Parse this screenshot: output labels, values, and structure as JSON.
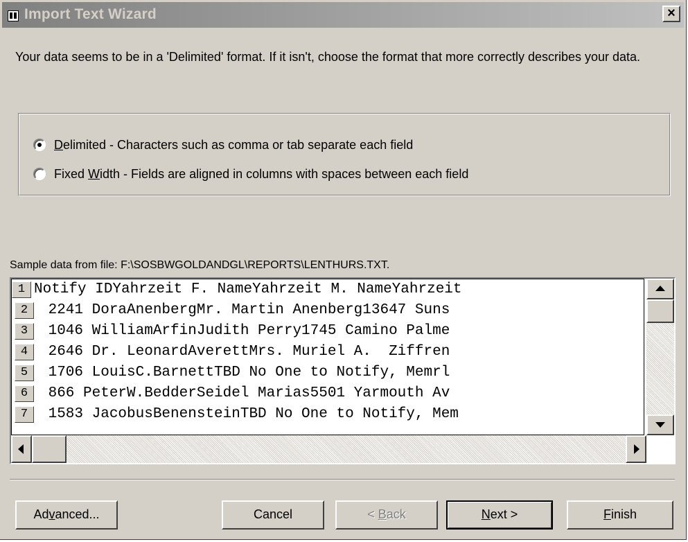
{
  "window": {
    "title": "Import Text Wizard",
    "close_label": "×"
  },
  "intro_text": "Your data seems to be in a 'Delimited' format. If it isn't, choose the format that more correctly describes your data.",
  "format_options": [
    {
      "label_accel": "D",
      "label_rest": "elimited - Characters such as comma or tab separate each field",
      "selected": true
    },
    {
      "label_before": "Fixed ",
      "label_accel": "W",
      "label_rest": "idth - Fields are aligned in columns with spaces between each field",
      "selected": false
    }
  ],
  "sample_label": "Sample data from file: F:\\SOSBWGOLDANDGL\\REPORTS\\LENTHURS.TXT.",
  "preview_rows": [
    {
      "num": "1",
      "text": "Notify IDYahrzeit F. NameYahrzeit M. NameYahrzeit"
    },
    {
      "num": "2",
      "text": " 2241 DoraAnenbergMr. Martin Anenberg13647 Suns"
    },
    {
      "num": "3",
      "text": " 1046 WilliamArfinJudith Perry1745 Camino Palme"
    },
    {
      "num": "4",
      "text": " 2646 Dr. LeonardAverettMrs. Muriel A.  Ziffren"
    },
    {
      "num": "5",
      "text": " 1706 LouisC.BarnettTBD No One to Notify, Memrl"
    },
    {
      "num": "6",
      "text": " 866 PeterW.BedderSeidel Marias5501 Yarmouth Av"
    },
    {
      "num": "7",
      "text": " 1583 JacobusBenensteinTBD No One to Notify, Mem"
    }
  ],
  "buttons": {
    "advanced": {
      "before": "Ad",
      "accel": "v",
      "after": "anced..."
    },
    "cancel": "Cancel",
    "back": {
      "before": "< ",
      "accel": "B",
      "after": "ack"
    },
    "next": {
      "before": "",
      "accel": "N",
      "after": "ext >"
    },
    "finish": {
      "before": "",
      "accel": "F",
      "after": "inish"
    }
  },
  "colors": {
    "face": "#d4d0c8",
    "title_gradient_start": "#808080",
    "title_gradient_end": "#c0c0c0"
  },
  "icons": [
    "app-icon",
    "close-icon",
    "scroll-up-arrow-icon",
    "scroll-down-arrow-icon",
    "scroll-left-arrow-icon",
    "scroll-right-arrow-icon"
  ]
}
